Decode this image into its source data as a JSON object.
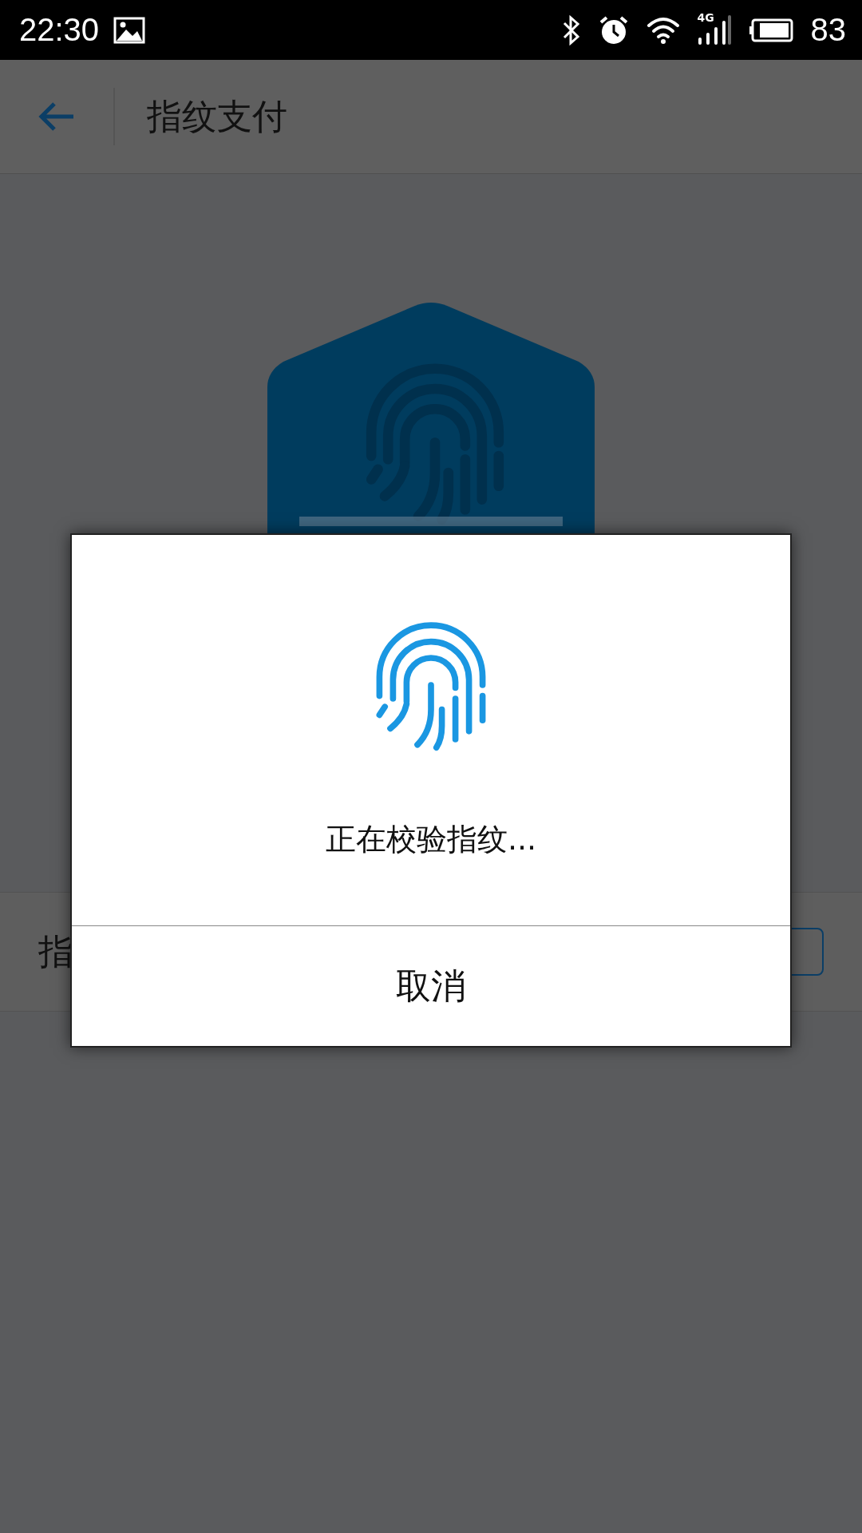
{
  "status_bar": {
    "time": "22:30",
    "network": "4G",
    "battery": "83"
  },
  "app_bar": {
    "title": "指纹支付"
  },
  "setting_row": {
    "label": "指"
  },
  "dialog": {
    "message": "正在校验指纹...",
    "buttons": [
      "取消"
    ]
  }
}
